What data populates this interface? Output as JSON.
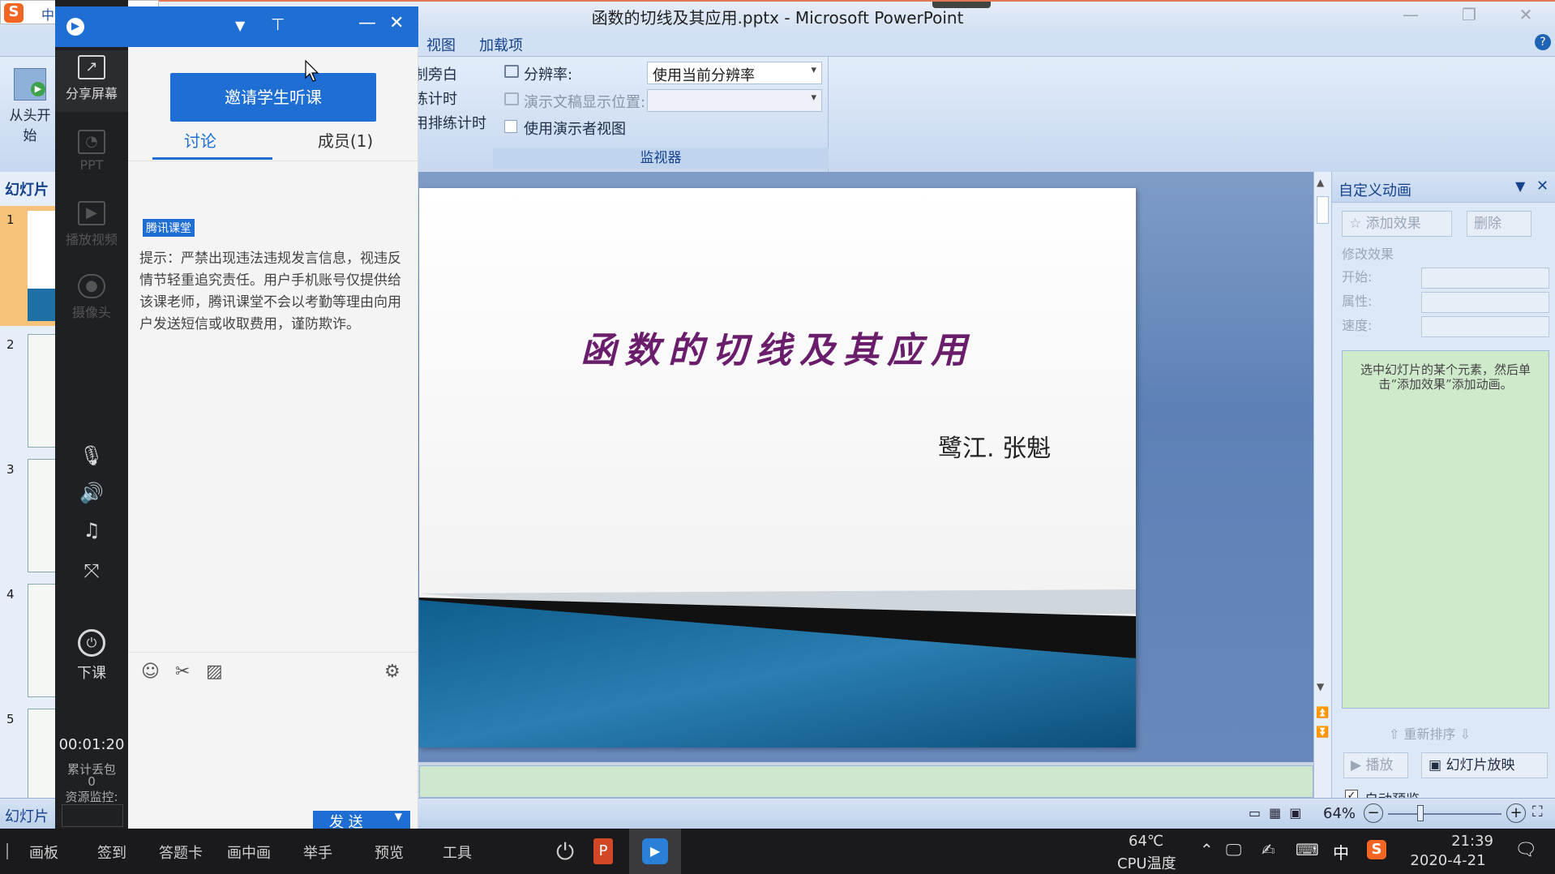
{
  "window": {
    "title": "函数的切线及其应用.pptx - Microsoft PowerPoint"
  },
  "ribbon": {
    "tabs": [
      "视图",
      "加载项"
    ],
    "from_start": "从头开始",
    "narration_partial": [
      "制旁白",
      "练计时",
      "用排练计时"
    ],
    "monitor": {
      "resolution_label": "分辨率:",
      "resolution_value": "使用当前分辨率",
      "show_on_label": "演示文稿显示位置:",
      "presenter_view_label": "使用演示者视图",
      "group_label": "监视器"
    }
  },
  "slides_pane": {
    "tab": "幻灯片",
    "numbers": [
      "1",
      "2",
      "3",
      "4",
      "5"
    ]
  },
  "slide": {
    "title": "函数的切线及其应用",
    "author": "鹭江. 张魁"
  },
  "anim_pane": {
    "title": "自定义动画",
    "add_effect": "添加效果",
    "remove": "删除",
    "modify": "修改效果",
    "start": "开始:",
    "property": "属性:",
    "speed": "速度:",
    "hint": "选中幻灯片的某个元素，然后单击“添加效果”添加动画。",
    "reorder": "重新排序",
    "play": "播放",
    "slideshow": "幻灯片放映",
    "autopreview": "自动预览"
  },
  "statusbar": {
    "tab": "幻灯片",
    "zoom": "64%"
  },
  "tencent": {
    "sidebar": [
      {
        "icon": "share-screen-icon",
        "label": "分享屏幕"
      },
      {
        "icon": "ppt-icon",
        "label": "PPT"
      },
      {
        "icon": "video-icon",
        "label": "播放视频"
      },
      {
        "icon": "camera-icon",
        "label": "摄像头"
      }
    ],
    "end_class": "下课",
    "timer": "00:01:20",
    "loss_label": "累计丢包",
    "loss_value": "0",
    "resource_label": "资源监控:",
    "invite_button": "邀请学生听课",
    "tab_discuss": "讨论",
    "tab_members": "成员(1)",
    "tag": "腾讯课堂",
    "notice": "提示：严禁出现违法违规发言信息，视违反情节轻重追究责任。用户手机账号仅提供给该课老师，腾讯课堂不会以考勤等理由向用户发送短信或收取费用，谨防欺诈。",
    "send": "发 送"
  },
  "taskbar": {
    "items": [
      "画板",
      "签到",
      "答题卡",
      "画中画",
      "举手",
      "预览",
      "工具"
    ],
    "cpu_temp": "64℃",
    "cpu_label": "CPU温度",
    "ime": "中",
    "time": "21:39",
    "date": "2020-4-21"
  }
}
